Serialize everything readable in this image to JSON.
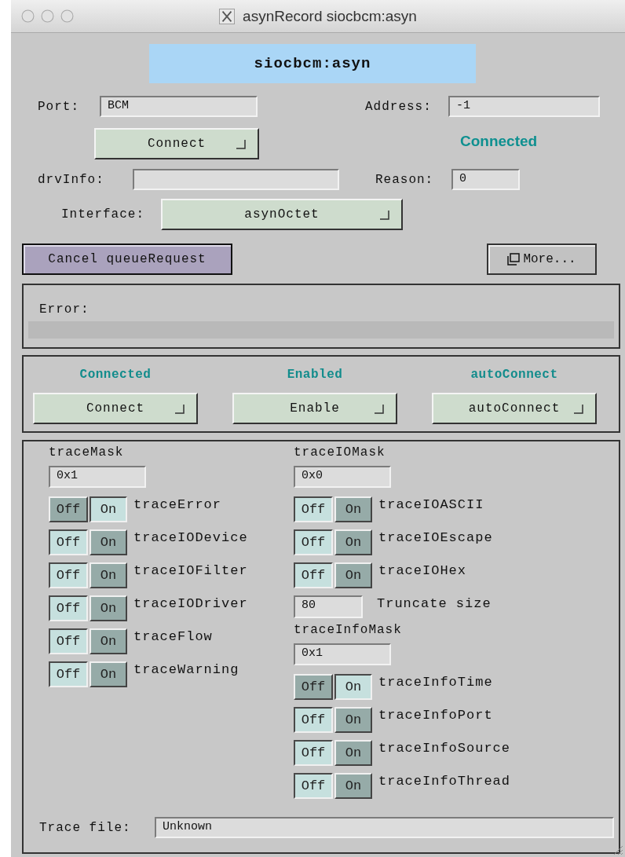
{
  "window": {
    "title": "asynRecord siocbcm:asyn"
  },
  "record_name": "siocbcm:asyn",
  "port": {
    "label": "Port:",
    "value": "BCM"
  },
  "address": {
    "label": "Address:",
    "value": "-1"
  },
  "connect_button": "Connect",
  "connection_status": "Connected",
  "drv_info": {
    "label": "drvInfo:"
  },
  "reason": {
    "label": "Reason:",
    "value": "0"
  },
  "interface": {
    "label": "Interface:",
    "value": "asynOctet"
  },
  "cancel_button": "Cancel queueRequest",
  "more_button": "More...",
  "error": {
    "label": "Error:"
  },
  "controls": [
    {
      "status": "Connected",
      "button": "Connect"
    },
    {
      "status": "Enabled",
      "button": "Enable"
    },
    {
      "status": "autoConnect",
      "button": "autoConnect"
    }
  ],
  "trace_mask": {
    "label": "traceMask",
    "value": "0x1",
    "bits": [
      {
        "name": "traceError",
        "on": true,
        "off_label": "Off",
        "on_label": "On"
      },
      {
        "name": "traceIODevice",
        "on": false,
        "off_label": "Off",
        "on_label": "On"
      },
      {
        "name": "traceIOFilter",
        "on": false,
        "off_label": "Off",
        "on_label": "On"
      },
      {
        "name": "traceIODriver",
        "on": false,
        "off_label": "Off",
        "on_label": "On"
      },
      {
        "name": "traceFlow",
        "on": false,
        "off_label": "Off",
        "on_label": "On"
      },
      {
        "name": "traceWarning",
        "on": false,
        "off_label": "Off",
        "on_label": "On"
      }
    ]
  },
  "trace_io_mask": {
    "label": "traceIOMask",
    "value": "0x0",
    "bits": [
      {
        "name": "traceIOASCII",
        "on": false,
        "off_label": "Off",
        "on_label": "On"
      },
      {
        "name": "traceIOEscape",
        "on": false,
        "off_label": "Off",
        "on_label": "On"
      },
      {
        "name": "traceIOHex",
        "on": false,
        "off_label": "Off",
        "on_label": "On"
      }
    ]
  },
  "truncate_size": {
    "value": "80",
    "label": "Truncate size"
  },
  "trace_info_mask": {
    "label": "traceInfoMask",
    "value": "0x1",
    "bits": [
      {
        "name": "traceInfoTime",
        "on": true,
        "off_label": "Off",
        "on_label": "On"
      },
      {
        "name": "traceInfoPort",
        "on": false,
        "off_label": "Off",
        "on_label": "On"
      },
      {
        "name": "traceInfoSource",
        "on": false,
        "off_label": "Off",
        "on_label": "On"
      },
      {
        "name": "traceInfoThread",
        "on": false,
        "off_label": "Off",
        "on_label": "On"
      }
    ]
  },
  "trace_file": {
    "label": "Trace file:",
    "value": "Unknown"
  }
}
